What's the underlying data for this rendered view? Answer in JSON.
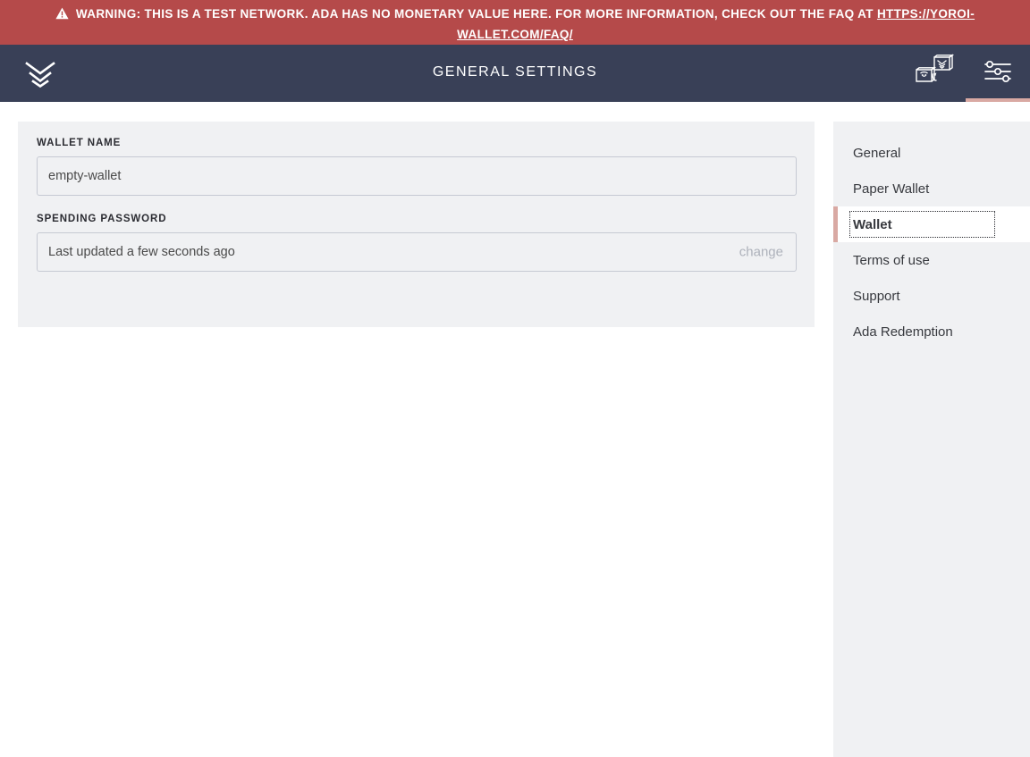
{
  "banner": {
    "icon": "warning-triangle-icon",
    "text": "WARNING: THIS IS A TEST NETWORK. ADA HAS NO MONETARY VALUE HERE. FOR MORE INFORMATION, CHECK OUT THE FAQ AT ",
    "link_text": "HTTPS://YOROI-WALLET.COM/FAQ/",
    "background_color": "#b54a4a",
    "text_color": "#ffffff"
  },
  "topbar": {
    "logo_icon": "yoroi-chevron-logo-icon",
    "title": "GENERAL SETTINGS",
    "background_color": "#394057",
    "actions": [
      {
        "name": "switch-wallet-button",
        "icon": "wallet-switch-icon",
        "active": false
      },
      {
        "name": "settings-button",
        "icon": "sliders-settings-icon",
        "active": true
      }
    ],
    "active_indicator_color": "#d9a9a3"
  },
  "settings_form": {
    "wallet_name": {
      "label": "WALLET NAME",
      "value": "empty-wallet",
      "placeholder": "Wallet name"
    },
    "spending_password": {
      "label": "SPENDING PASSWORD",
      "status": "Last updated a few seconds ago",
      "change_label": "change"
    }
  },
  "settings_menu": {
    "items": [
      {
        "label": "General",
        "active": false
      },
      {
        "label": "Paper Wallet",
        "active": false
      },
      {
        "label": "Wallet",
        "active": true
      },
      {
        "label": "Terms of use",
        "active": false
      },
      {
        "label": "Support",
        "active": false
      },
      {
        "label": "Ada Redemption",
        "active": false
      }
    ],
    "accent_color": "#d9a9a3",
    "background_color": "#f0f1f3"
  }
}
